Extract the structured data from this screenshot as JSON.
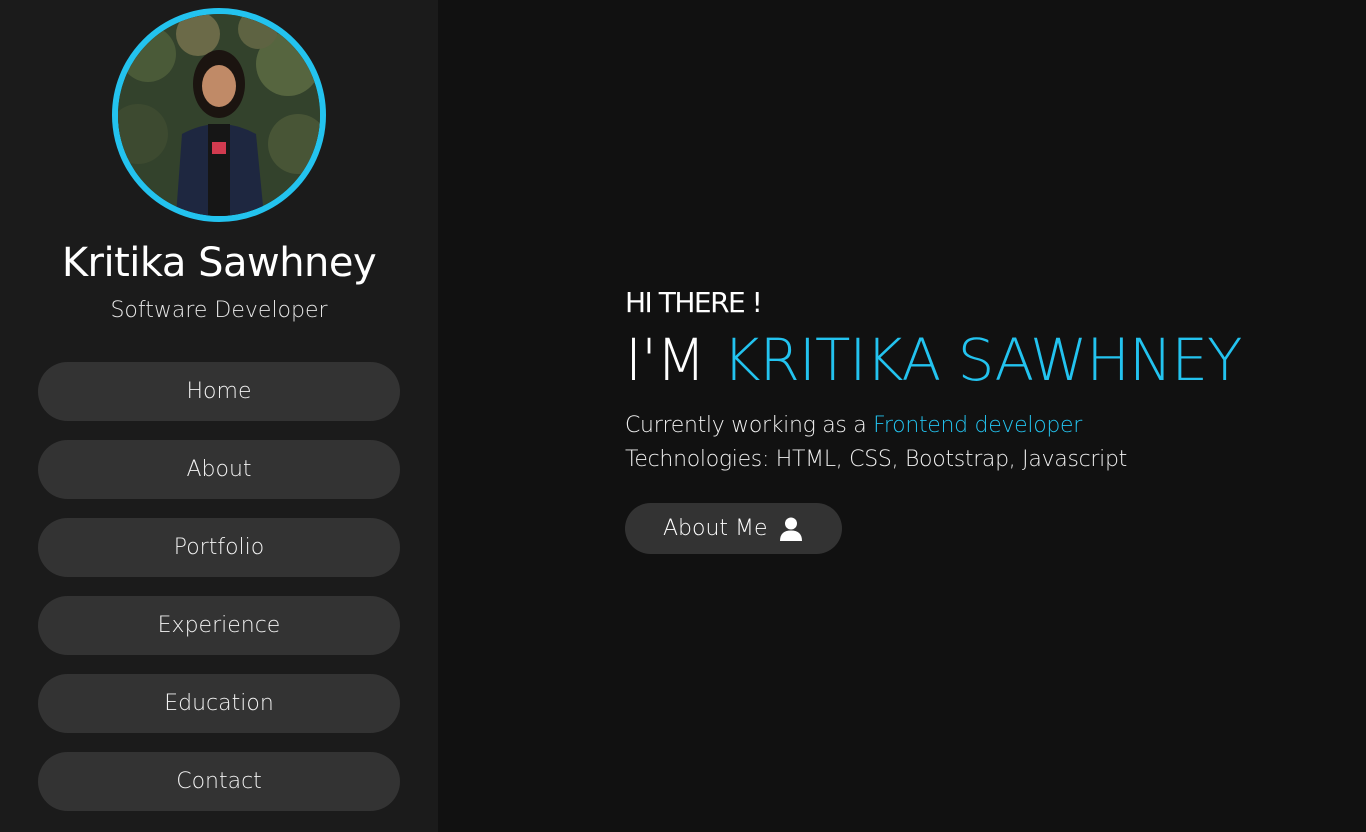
{
  "profile": {
    "name": "Kritika Sawhney",
    "role": "Software Developer"
  },
  "nav": {
    "items": [
      {
        "label": "Home"
      },
      {
        "label": "About"
      },
      {
        "label": "Portfolio"
      },
      {
        "label": "Experience"
      },
      {
        "label": "Education"
      },
      {
        "label": "Contact"
      }
    ]
  },
  "hero": {
    "greeting": "HI THERE !",
    "headline_prefix": "I'M ",
    "headline_name": "KRITIKA SAWHNEY",
    "intro_prefix": "Currently working as a ",
    "intro_role": "Frontend developer",
    "technologies": "Technologies: HTML, CSS, Bootstrap, Javascript",
    "button_label": "About Me",
    "button_icon": "user-icon"
  },
  "colors": {
    "accent": "#23c3ef",
    "sidebar_bg": "#1b1b1b",
    "main_bg": "#111111",
    "button_bg": "#333333"
  }
}
